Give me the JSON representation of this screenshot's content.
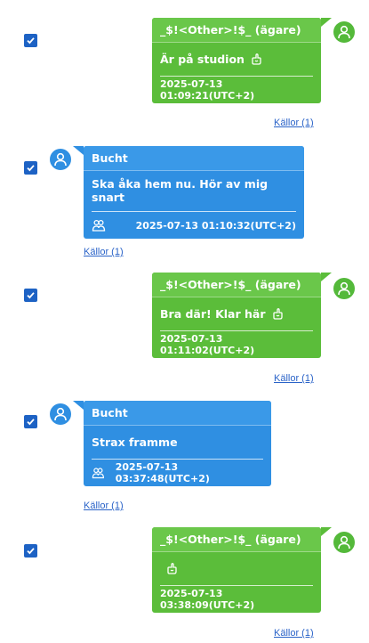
{
  "source_link_label": "Källor (1)",
  "colors": {
    "outgoing": "#5bbd3a",
    "incoming": "#2f8fe2",
    "checkbox": "#1d62c4",
    "link": "#2a63c8"
  },
  "messages": [
    {
      "direction": "outgoing",
      "sender": "_$!<Other>!$_ (ägare)",
      "text": "Är på studion",
      "timestamp": "2025-07-13 01:09:21(UTC+2)",
      "checked": true,
      "icon": "hand-icon"
    },
    {
      "direction": "incoming",
      "sender": "Bucht",
      "text": "Ska åka hem nu. Hör av mig snart",
      "timestamp": "2025-07-13 01:10:32(UTC+2)",
      "checked": true,
      "icon": "group-icon"
    },
    {
      "direction": "outgoing",
      "sender": "_$!<Other>!$_ (ägare)",
      "text": "Bra där! Klar här",
      "timestamp": "2025-07-13 01:11:02(UTC+2)",
      "checked": true,
      "icon": "hand-icon"
    },
    {
      "direction": "incoming",
      "sender": "Bucht",
      "text": "Strax framme",
      "timestamp": "2025-07-13 03:37:48(UTC+2)",
      "checked": true,
      "icon": "group-icon"
    },
    {
      "direction": "outgoing",
      "sender": "_$!<Other>!$_ (ägare)",
      "text": "",
      "timestamp": "2025-07-13 03:38:09(UTC+2)",
      "checked": true,
      "icon": "hand-icon"
    }
  ]
}
